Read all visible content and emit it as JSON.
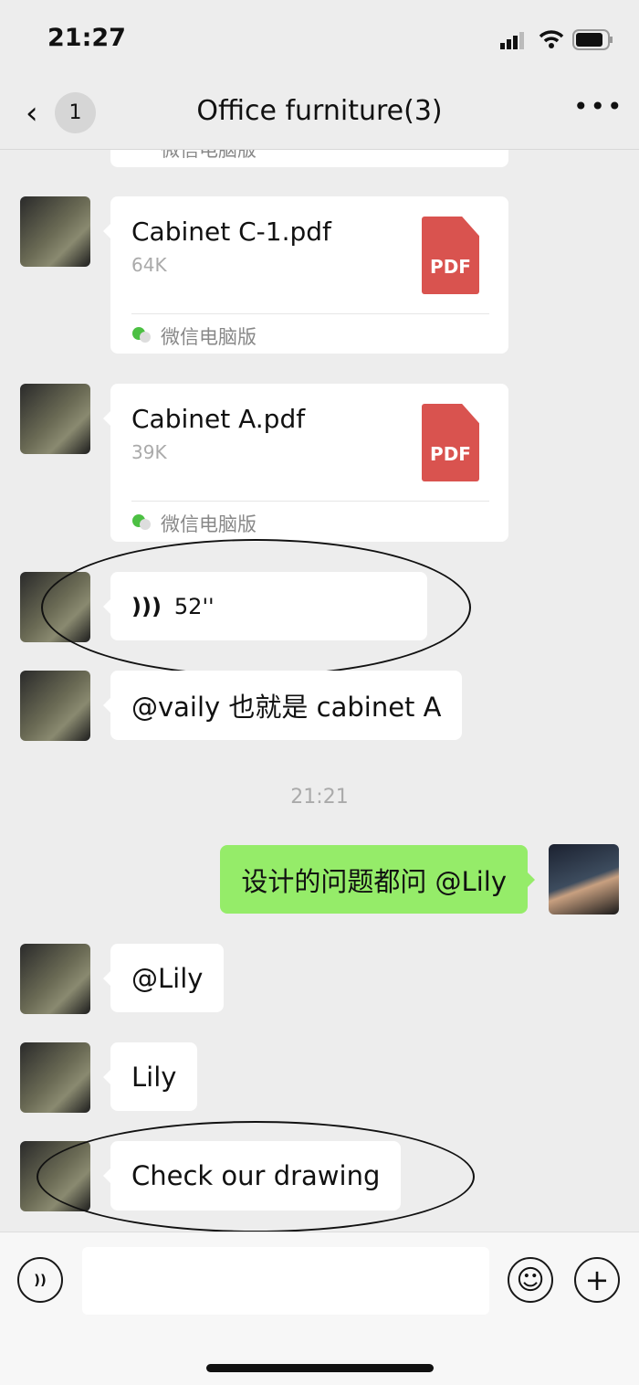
{
  "status_bar": {
    "time": "21:27"
  },
  "header": {
    "title": "Office furniture(3)",
    "unread_count": "1"
  },
  "messages": [
    {
      "type": "file",
      "name": "Cabinet C-1.pdf",
      "size": "64K",
      "icon": "PDF",
      "source": "微信电脑版"
    },
    {
      "type": "file",
      "name": "Cabinet A.pdf",
      "size": "39K",
      "icon": "PDF",
      "source": "微信电脑版"
    },
    {
      "type": "voice",
      "duration": "52''"
    },
    {
      "type": "text",
      "text": "@vaily 也就是 cabinet A"
    },
    {
      "type": "timestamp",
      "text": "21:21"
    },
    {
      "type": "text",
      "from": "me",
      "text": "设计的问题都问 @Lily"
    },
    {
      "type": "text",
      "text": "@Lily"
    },
    {
      "type": "text",
      "text": "Lily"
    },
    {
      "type": "text",
      "text": "Check our drawing"
    }
  ],
  "partial_top": {
    "source": "微信电脑版"
  },
  "colors": {
    "background": "#EDEDED",
    "sent_bubble": "#95EC69",
    "pdf": "#D9534F"
  }
}
